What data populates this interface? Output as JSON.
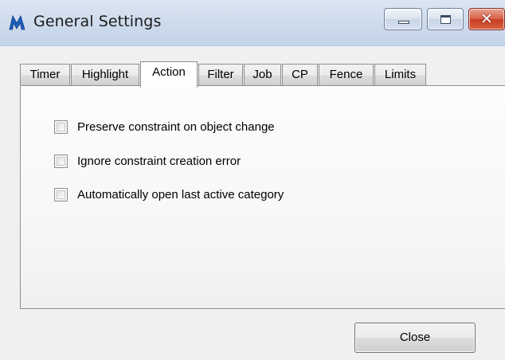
{
  "window": {
    "title": "General Settings",
    "icon": "app-logo-icon",
    "controls": {
      "minimize": "minimize-icon",
      "maximize": "maximize-icon",
      "close": "close-icon"
    }
  },
  "tabs": [
    {
      "label": "Timer",
      "active": false
    },
    {
      "label": "Highlight",
      "active": false
    },
    {
      "label": "Action",
      "active": true
    },
    {
      "label": "Filter",
      "active": false
    },
    {
      "label": "Job",
      "active": false
    },
    {
      "label": "CP",
      "active": false
    },
    {
      "label": "Fence",
      "active": false
    },
    {
      "label": "Limits",
      "active": false
    }
  ],
  "action_panel": {
    "options": [
      {
        "label": "Preserve constraint on object change",
        "checked": false
      },
      {
        "label": "Ignore constraint creation error",
        "checked": false
      },
      {
        "label": "Automatically open last active category",
        "checked": false
      }
    ]
  },
  "footer": {
    "close_label": "Close"
  },
  "colors": {
    "titlebar": "#cfdcec",
    "window_bg": "#f0f0f0",
    "close_button_red": "#c73e22",
    "app_icon_blue": "#1f5fbf"
  }
}
